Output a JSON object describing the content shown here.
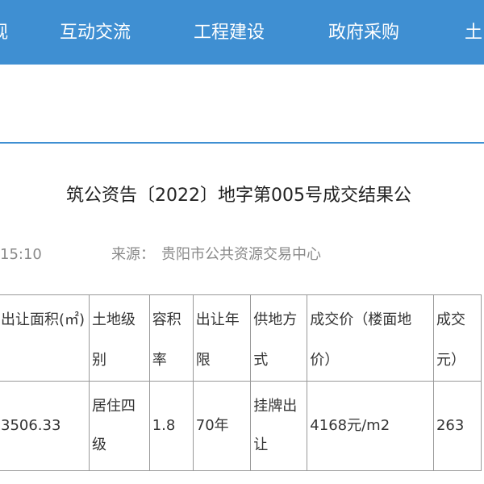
{
  "nav": {
    "items": [
      "观",
      "互动交流",
      "工程建设",
      "政府采购",
      "土"
    ]
  },
  "article": {
    "title": "筑公资告〔2022〕地字第005号成交结果公",
    "time": "15:10",
    "source_label": "来源：",
    "source": "贵阳市公共资源交易中心"
  },
  "table": {
    "headers": [
      "出让面积(㎡)",
      "土地级别",
      "容积率",
      "出让年限",
      "供地方式",
      "成交价（楼面地价）",
      "成交元）"
    ],
    "rows": [
      [
        "3506.33",
        "居住四级",
        "1.8",
        "70年",
        "挂牌出让",
        "4168元/m2",
        "263"
      ]
    ]
  },
  "colors": {
    "nav_background": "#3f8fd2",
    "nav_text": "#ffffff",
    "meta_text": "#8a8a8a",
    "table_border": "#999999"
  }
}
